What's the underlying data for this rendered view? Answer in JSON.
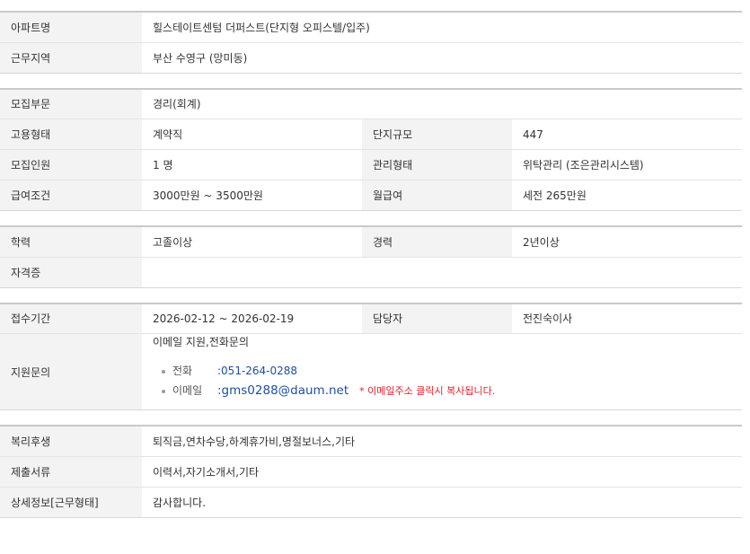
{
  "sec1": {
    "apt_label": "아파트명",
    "apt_value": "힐스테이트센텀 더퍼스트(단지형 오피스텔/입주)",
    "area_label": "근무지역",
    "area_value": "부산 수영구 (망미동)"
  },
  "sec2": {
    "dept_label": "모집부문",
    "dept_value": "경리(회계)",
    "emp_label": "고용형태",
    "emp_value": "계약직",
    "size_label": "단지규모",
    "size_value": "447",
    "count_label": "모집인원",
    "count_value": "1 명",
    "mgmt_label": "관리형태",
    "mgmt_value": "위탁관리 (조은관리시스템)",
    "salary_label": "급여조건",
    "salary_value": "3000만원 ~ 3500만원",
    "monthly_label": "월급여",
    "monthly_value": "세전 265만원"
  },
  "sec3": {
    "edu_label": "학력",
    "edu_value": "고졸이상",
    "exp_label": "경력",
    "exp_value": "2년이상",
    "cert_label": "자격증",
    "cert_value": ""
  },
  "sec4": {
    "period_label": "접수기간",
    "period_value": "2026-02-12 ~ 2026-02-19",
    "manager_label": "담당자",
    "manager_value": "전진숙이사",
    "inquiry_label": "지원문의",
    "inquiry_intro": "이메일 지원,전화문의",
    "tel_label": "전화",
    "tel_value": ":051-264-0288",
    "email_label": "이메일",
    "email_value": ":gms0288@daum.net",
    "email_note": "* 이메일주소 클릭시 복사됩니다."
  },
  "sec5": {
    "welfare_label": "복리후생",
    "welfare_value": "퇴직금,연차수당,하계휴가비,명절보너스,기타",
    "docs_label": "제출서류",
    "docs_value": "이력서,자기소개서,기타",
    "detail_label": "상세정보[근무형태]",
    "detail_value": "감사합니다."
  },
  "colors": {
    "label_bg": "#f3f3f3",
    "link": "#1f4fa3",
    "notice": "#e2202d"
  }
}
